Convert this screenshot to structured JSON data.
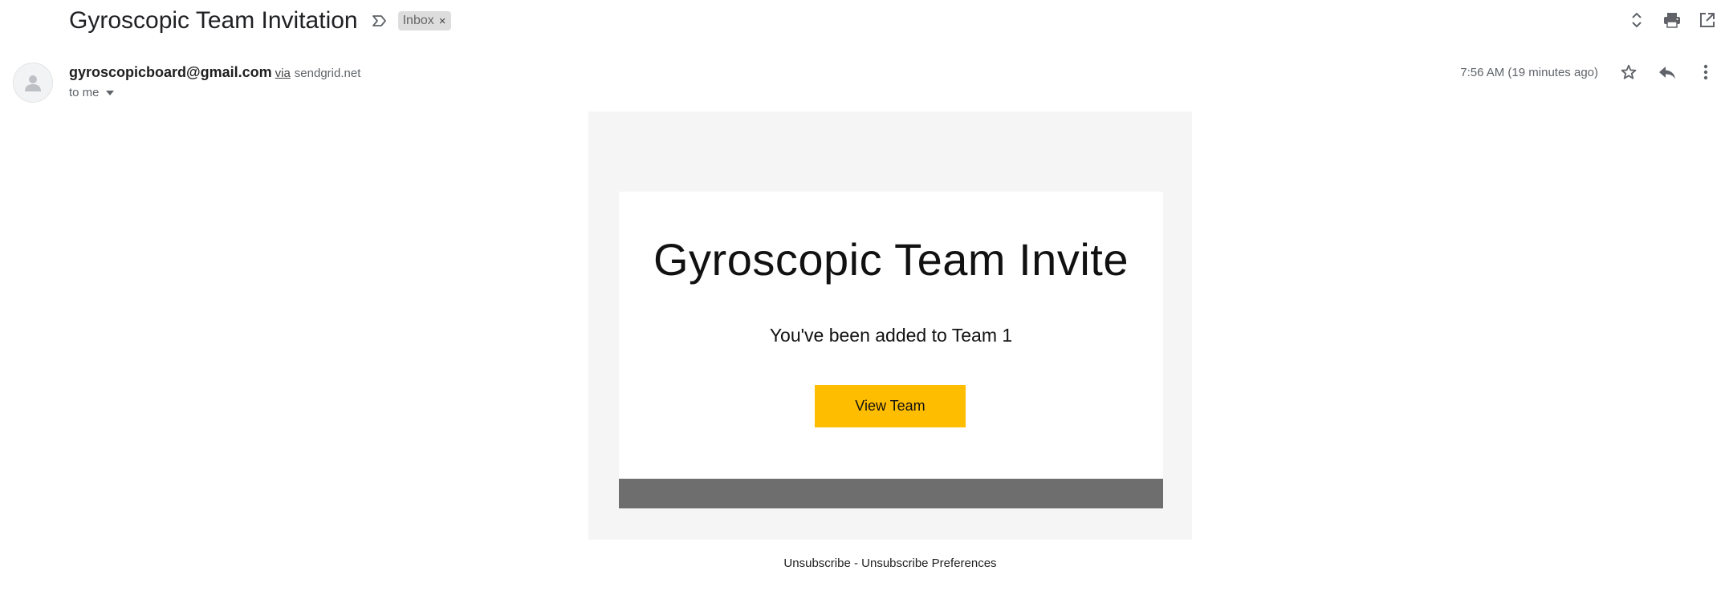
{
  "subject": "Gyroscopic Team Invitation",
  "label_chip": {
    "label": "Inbox",
    "remove_symbol": "×"
  },
  "top_actions": [
    "expand-collapse-icon",
    "print-icon",
    "open-in-new-window-icon"
  ],
  "sender": {
    "email": "gyroscopicboard@gmail.com",
    "via_label": "via",
    "via_domain": "sendgrid.net",
    "recipient_label": "to me",
    "avatar_icon": "person-icon"
  },
  "timestamp": "7:56 AM (19 minutes ago)",
  "message_actions": [
    "star-icon",
    "reply-icon",
    "more-vert-icon"
  ],
  "email": {
    "title": "Gyroscopic Team Invite",
    "subtitle": "You've been added to Team 1",
    "button_label": "View Team",
    "footer": {
      "unsubscribe": "Unsubscribe",
      "separator": " - ",
      "preferences": "Unsubscribe Preferences"
    }
  },
  "colors": {
    "accent_button": "#ffbd00",
    "outer_background": "#f5f5f5",
    "footer_bar": "#6e6e6e",
    "chip_background": "#dddddd"
  }
}
